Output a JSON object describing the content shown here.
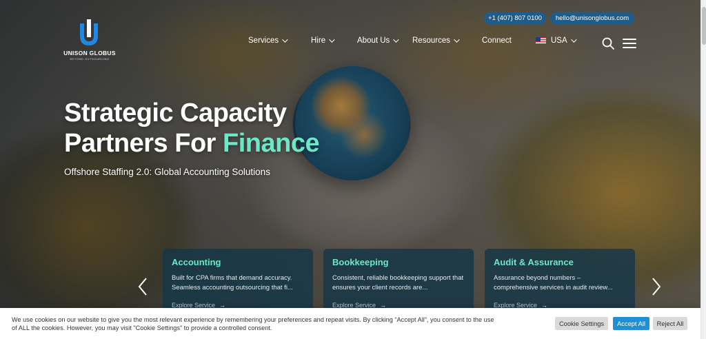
{
  "brand": {
    "name": "UNISON GLOBUS",
    "tagline": "BEYOND OUTSOURCING",
    "color": "#1e88e5"
  },
  "contact": {
    "phone": "+1 (407) 807 0100",
    "email": "hello@unisonglobus.com"
  },
  "nav": {
    "items": [
      {
        "label": "Services",
        "has_dropdown": true
      },
      {
        "label": "Hire",
        "has_dropdown": true
      },
      {
        "label": "About Us",
        "has_dropdown": true
      },
      {
        "label": "Resources",
        "has_dropdown": true
      },
      {
        "label": "Connect",
        "has_dropdown": false
      }
    ],
    "region": {
      "label": "USA",
      "icon": "us-flag-icon",
      "has_dropdown": true
    },
    "search_icon": "search-icon",
    "menu_icon": "hamburger-menu-icon"
  },
  "hero": {
    "headline_line1": "Strategic Capacity",
    "headline_line2_prefix": "Partners For ",
    "headline_accent": "Finance",
    "accent_color": "#6ee7c9",
    "subheadline": "Offshore Staffing 2.0: Global Accounting Solutions"
  },
  "cards": [
    {
      "title": "Accounting",
      "description": "Built for CPA firms that demand accuracy. Seamless accounting outsourcing that fi...",
      "link": "Explore Service"
    },
    {
      "title": "Bookkeeping",
      "description": "Consistent, reliable bookkeeping support that ensures your client records are...",
      "link": "Explore Service"
    },
    {
      "title": "Audit & Assurance",
      "description": "Assurance beyond numbers – comprehensive services in audit review...",
      "link": "Explore Service"
    }
  ],
  "carousel": {
    "prev_icon": "chevron-left-icon",
    "next_icon": "chevron-right-icon"
  },
  "cookie": {
    "text": "We use cookies on our website to give you the most relevant experience by remembering your preferences and repeat visits. By clicking “Accept All”, you consent to the use of ALL the cookies. However, you may visit \"Cookie Settings\" to provide a controlled consent.",
    "settings_label": "Cookie Settings",
    "accept_label": "Accept All",
    "reject_label": "Reject All",
    "accept_color": "#1f8fd6"
  }
}
